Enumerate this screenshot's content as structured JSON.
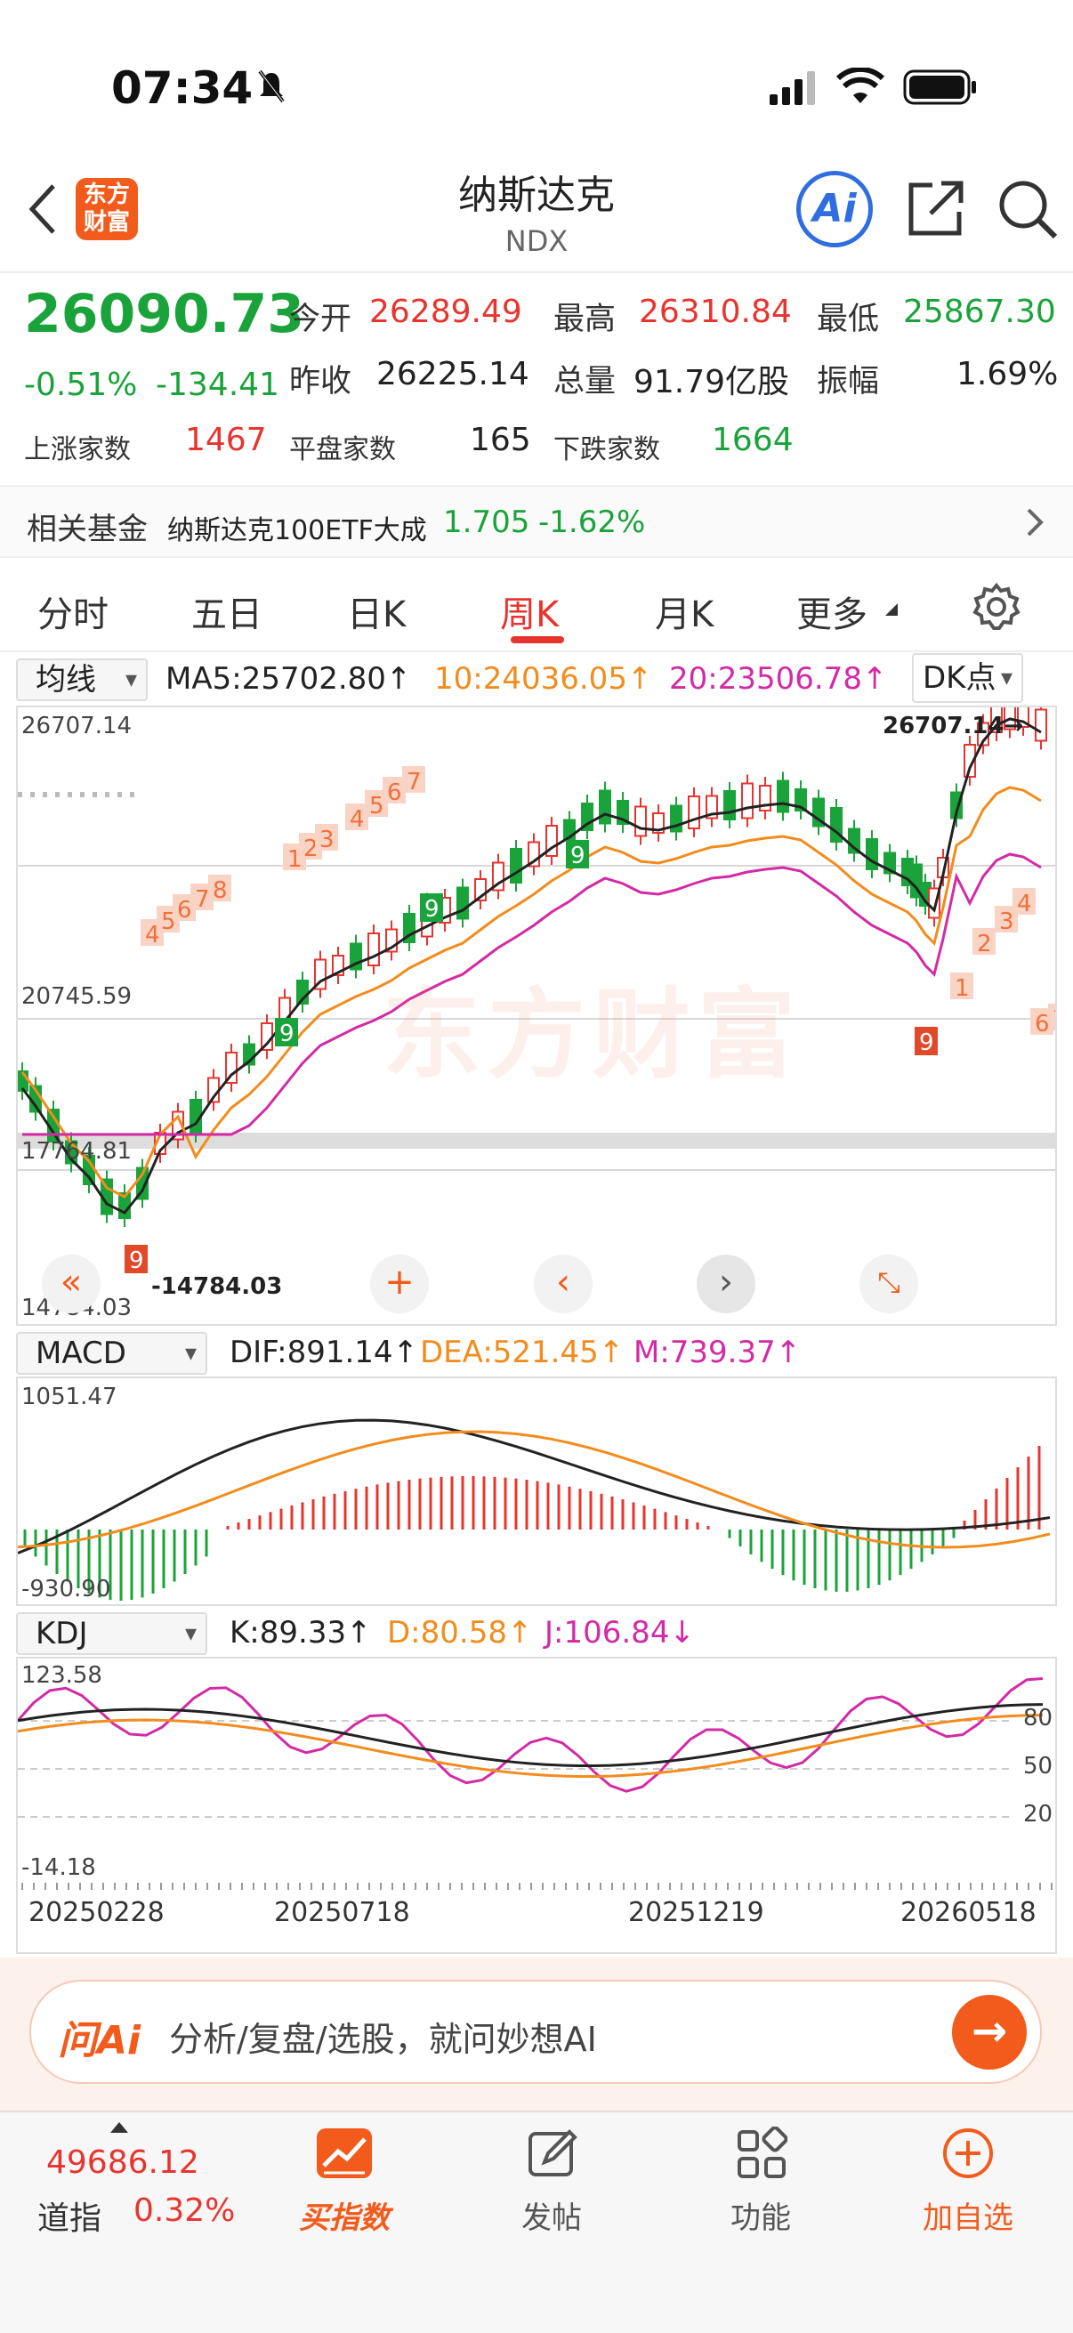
{
  "status": {
    "time": "07:34"
  },
  "nav": {
    "title": "纳斯达克",
    "code": "NDX",
    "logo": "东方\n财富",
    "ai": "Ai"
  },
  "quote": {
    "price": "26090.73",
    "change_pct": "-0.51%",
    "change": "-134.41",
    "open_label": "今开",
    "open": "26289.49",
    "high_label": "最高",
    "high": "26310.84",
    "low_label": "最低",
    "low": "25867.30",
    "prev_label": "昨收",
    "prev": "26225.14",
    "vol_label": "总量",
    "vol": "91.79亿股",
    "amp_label": "振幅",
    "amp": "1.69%",
    "up_label": "上涨家数",
    "up": "1467",
    "flat_label": "平盘家数",
    "flat": "165",
    "down_label": "下跌家数",
    "down": "1664"
  },
  "fund": {
    "label": "相关基金",
    "name": "纳斯达克100ETF大成",
    "price": "1.705",
    "pct": "-1.62%"
  },
  "tabs": [
    "分时",
    "五日",
    "日K",
    "周K",
    "月K",
    "更多"
  ],
  "active_tab": "周K",
  "kline": {
    "ma_select": "均线",
    "ma5": "MA5:25702.80↑",
    "ma10": "10:24036.05↑",
    "ma20": "20:23506.78↑",
    "dk": "DK点",
    "max": "26707.14",
    "max_marker": "26707.14→",
    "mid": "20745.59",
    "mid2": "17764.81",
    "min": "14784.03",
    "min_marker": "-14784.03",
    "watermark": "东方财富"
  },
  "macd": {
    "select": "MACD",
    "dif": "DIF:891.14↑",
    "dea": "DEA:521.45↑",
    "m": "M:739.37↑",
    "max": "1051.47",
    "min": "-930.90"
  },
  "kdj": {
    "select": "KDJ",
    "k": "K:89.33↑",
    "d": "D:80.58↑",
    "j": "J:106.84↓",
    "max": "123.58",
    "min": "-14.18",
    "l80": "80",
    "l50": "50",
    "l20": "20"
  },
  "dates": [
    "20250228",
    "20250718",
    "20251219",
    "20260518"
  ],
  "ai_bar": {
    "brand": "问Ai",
    "placeholder": "分析/复盘/选股，就问妙想AI"
  },
  "bottom": {
    "index_value": "49686.12",
    "index_name": "道指",
    "index_pct": "0.32%",
    "buy": "买指数",
    "post": "发帖",
    "func": "功能",
    "add": "加自选"
  },
  "colors": {
    "up": "#e8342f",
    "down": "#1aa33a",
    "ma10": "#f28c1c",
    "ma20": "#d32aa6",
    "brand": "#f25b1c"
  }
}
